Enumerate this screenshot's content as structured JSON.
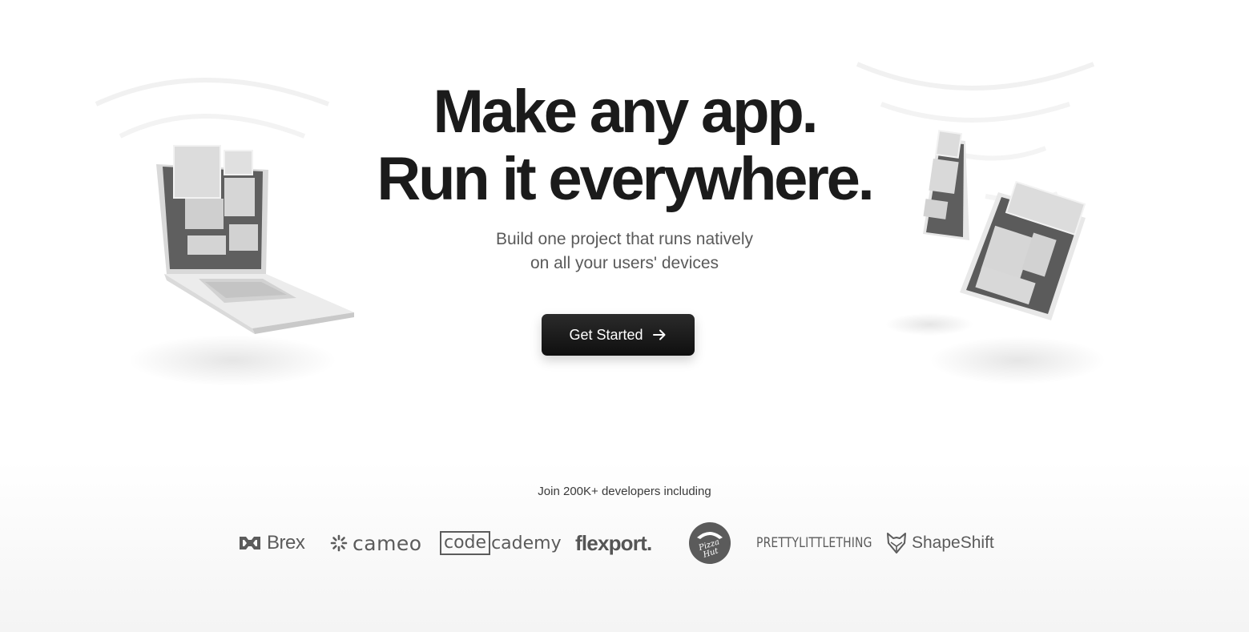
{
  "hero": {
    "headline_line1": "Make any app.",
    "headline_line2": "Run it everywhere.",
    "subtitle_line1": "Build one project that runs natively",
    "subtitle_line2": "on all your users' devices",
    "cta_label": "Get Started",
    "cta_icon": "arrow-right-icon"
  },
  "proof": {
    "title": "Join 200K+ developers including",
    "logos": {
      "brex": "Brex",
      "cameo": "cameo",
      "codecademy_box": "code",
      "codecademy_rest": "cademy",
      "flexport": "flexport.",
      "pizzahut": "Pizza Hut",
      "prettylittlething": "PRETTYLITTLETHING",
      "shapeshift": "ShapeShift"
    }
  },
  "colors": {
    "text_primary": "#1b1b1b",
    "text_secondary": "#5a5a5a",
    "button_bg": "#1a1a1a",
    "button_text": "#ffffff",
    "logo_gray": "#5b5b5b"
  }
}
